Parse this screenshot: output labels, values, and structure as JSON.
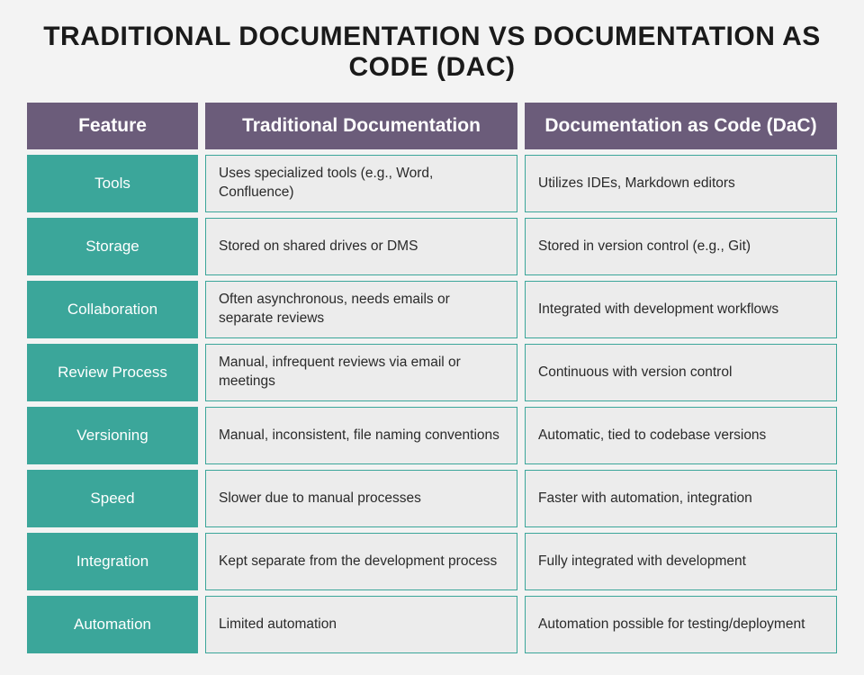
{
  "title": "TRADITIONAL DOCUMENTATION VS DOCUMENTATION AS CODE (DAC)",
  "headers": {
    "feature": "Feature",
    "trad": "Traditional Documentation",
    "dac": "Documentation as Code (DaC)"
  },
  "rows": [
    {
      "feature": "Tools",
      "trad": "Uses specialized tools (e.g., Word, Confluence)",
      "dac": "Utilizes IDEs, Markdown editors"
    },
    {
      "feature": "Storage",
      "trad": "Stored on shared drives or DMS",
      "dac": "Stored in version control (e.g., Git)"
    },
    {
      "feature": "Collaboration",
      "trad": "Often asynchronous, needs emails or separate reviews",
      "dac": "Integrated with development workflows"
    },
    {
      "feature": "Review Process",
      "trad": "Manual, infrequent reviews via email or meetings",
      "dac": "Continuous with version control"
    },
    {
      "feature": "Versioning",
      "trad": "Manual, inconsistent, file naming conventions",
      "dac": "Automatic, tied to codebase versions"
    },
    {
      "feature": "Speed",
      "trad": "Slower due to manual processes",
      "dac": "Faster with automation, integration"
    },
    {
      "feature": "Integration",
      "trad": "Kept separate from the development process",
      "dac": "Fully integrated with development"
    },
    {
      "feature": "Automation",
      "trad": "Limited automation",
      "dac": "Automation possible for testing/deployment"
    }
  ]
}
